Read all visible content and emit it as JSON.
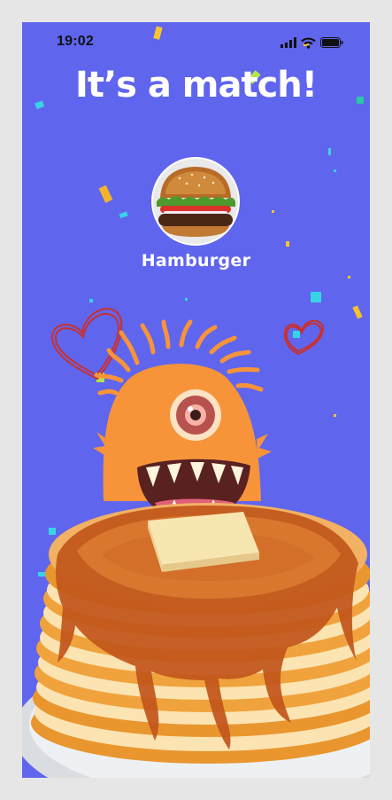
{
  "status_bar": {
    "time": "19:02",
    "icons": [
      "cellular-signal-icon",
      "wifi-icon",
      "battery-icon"
    ]
  },
  "match": {
    "title": "It’s a match!",
    "food_name": "Hamburger"
  },
  "colors": {
    "background": "#6065ee",
    "monster": "#f7943a",
    "heart": "#c9302c",
    "syrup": "#c2561c",
    "pancake": "#f2b264",
    "butter": "#f8e6b0"
  }
}
